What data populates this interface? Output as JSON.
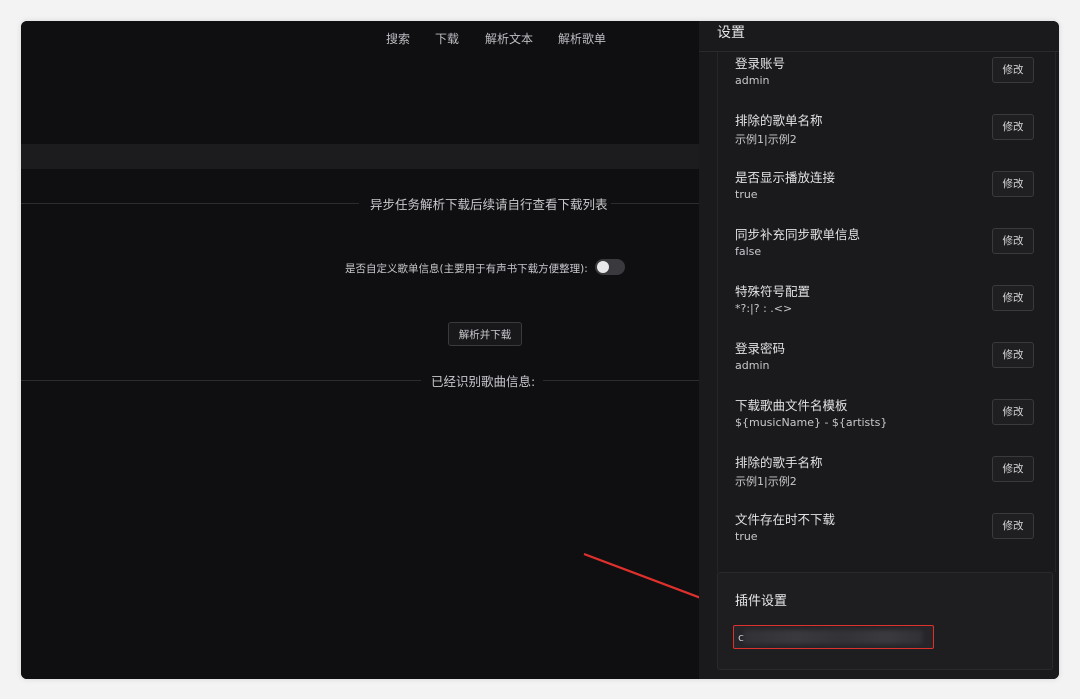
{
  "nav": {
    "items": [
      {
        "label": "搜索"
      },
      {
        "label": "下载"
      },
      {
        "label": "解析文本"
      },
      {
        "label": "解析歌单"
      }
    ]
  },
  "main": {
    "async_notice": "异步任务解析下载后续请自行查看下载列表",
    "custom_info_label": "是否自定义歌单信息(主要用于有声书下载方便整理):",
    "custom_info_enabled": false,
    "parse_button": "解析并下载",
    "recognized_title": "已经识别歌曲信息:"
  },
  "drawer": {
    "title": "设置",
    "edit_label": "修改",
    "settings": [
      {
        "label": "登录账号",
        "value": "admin"
      },
      {
        "label": "排除的歌单名称",
        "value": "示例1|示例2"
      },
      {
        "label": "是否显示播放连接",
        "value": "true"
      },
      {
        "label": "同步补充同步歌单信息",
        "value": "false"
      },
      {
        "label": "特殊符号配置",
        "value": "*?:|? : .<>"
      },
      {
        "label": "登录密码",
        "value": "admin"
      },
      {
        "label": "下载歌曲文件名模板",
        "value": "${musicName} - ${artists}"
      },
      {
        "label": "排除的歌手名称",
        "value": "示例1|示例2"
      },
      {
        "label": "文件存在时不下载",
        "value": "true"
      }
    ],
    "plugin": {
      "title": "插件设置",
      "input_value": "c"
    }
  },
  "colors": {
    "background": "#0f0f12",
    "drawer": "#1a1a1d",
    "highlight": "#e0302c"
  }
}
